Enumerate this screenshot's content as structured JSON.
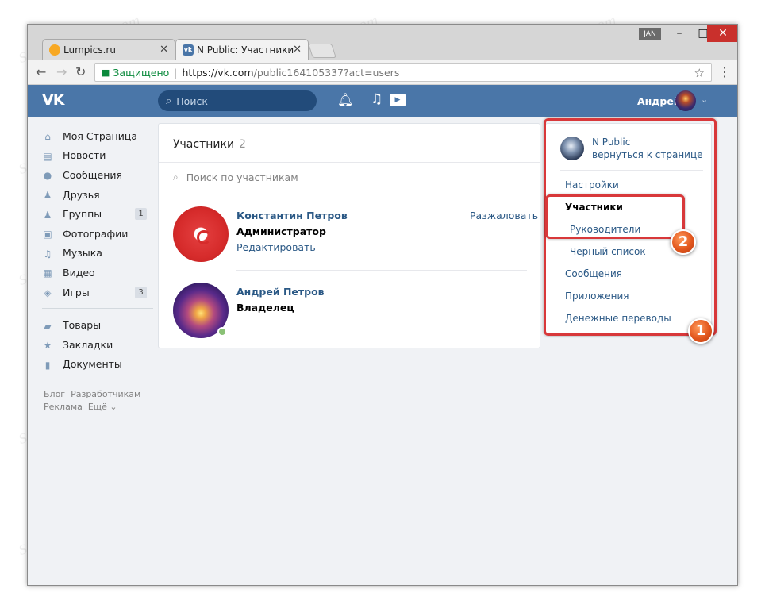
{
  "browser": {
    "tabs": [
      {
        "title": "Lumpics.ru",
        "favicon_color": "#f7a823",
        "active": false
      },
      {
        "title": "N Public: Участники",
        "favicon_color": "#4a76a8",
        "active": true
      }
    ],
    "jan_label": "JAN",
    "window_buttons": {
      "minimize": "–",
      "maximize": "□",
      "close": "✕"
    },
    "secure_label": "Защищено",
    "url_host": "https://vk.com",
    "url_path": "/public164105337?act=users"
  },
  "vk_header": {
    "logo": "VK",
    "search_placeholder": "Поиск",
    "user_name": "Андрей"
  },
  "sidebar": {
    "items": [
      {
        "label": "Моя Страница",
        "icon": "home-icon",
        "glyph": "⌂"
      },
      {
        "label": "Новости",
        "icon": "news-icon",
        "glyph": "▤"
      },
      {
        "label": "Сообщения",
        "icon": "messages-icon",
        "glyph": "●"
      },
      {
        "label": "Друзья",
        "icon": "friends-icon",
        "glyph": "♟"
      },
      {
        "label": "Группы",
        "icon": "groups-icon",
        "glyph": "♟",
        "badge": "1"
      },
      {
        "label": "Фотографии",
        "icon": "camera-icon",
        "glyph": "▣"
      },
      {
        "label": "Музыка",
        "icon": "music-icon",
        "glyph": "♫"
      },
      {
        "label": "Видео",
        "icon": "video-icon",
        "glyph": "▦"
      },
      {
        "label": "Игры",
        "icon": "gamepad-icon",
        "glyph": "◈",
        "badge": "3"
      }
    ],
    "items2": [
      {
        "label": "Товары",
        "icon": "bag-icon",
        "glyph": "▰"
      },
      {
        "label": "Закладки",
        "icon": "star-icon",
        "glyph": "★"
      },
      {
        "label": "Документы",
        "icon": "document-icon",
        "glyph": "▮"
      }
    ],
    "footer": [
      "Блог",
      "Разработчикам",
      "Реклама",
      "Ещё ⌄"
    ]
  },
  "members": {
    "title": "Участники",
    "count": "2",
    "search_placeholder": "Поиск по участникам",
    "list": [
      {
        "name": "Константин Петров",
        "role": "Администратор",
        "edit": "Редактировать",
        "action": "Разжаловать"
      },
      {
        "name": "Андрей Петров",
        "role": "Владелец"
      }
    ]
  },
  "right_menu": {
    "group_name": "N Public",
    "back_link": "вернуться к странице",
    "items": [
      "Настройки",
      "Участники",
      "Руководители",
      "Черный список",
      "Сообщения",
      "Приложения",
      "Денежные переводы"
    ]
  },
  "annotations": {
    "marker1": "1",
    "marker2": "2"
  },
  "watermark": "Soringpcrepair.com"
}
